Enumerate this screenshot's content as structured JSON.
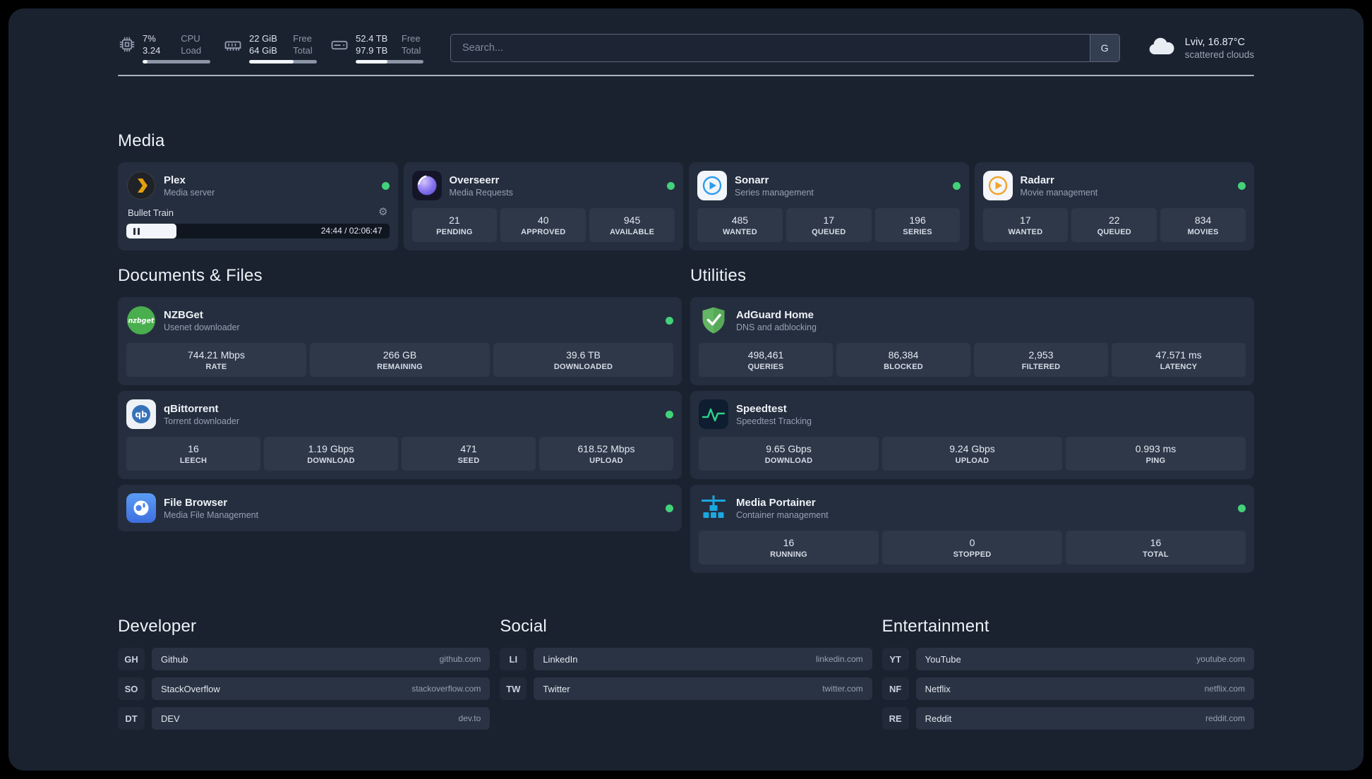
{
  "colors": {
    "status_online": "#43d17a",
    "plex_gold": "#e5a00d",
    "overseerr_purple": "#8b78f0",
    "sonarr_blue": "#2f9ceb",
    "radarr_amber": "#f0a42c",
    "nzbget_green": "#49ae4d",
    "qbittorrent_blue": "#3672b9",
    "filebrowser_blue": "#4b84ea",
    "adguard_green": "#63b663",
    "speedtest_green": "#2bd489",
    "portainer_blue": "#1ba7e0"
  },
  "topbar": {
    "cpu": {
      "icon": "cpu-icon",
      "value_top": "7%",
      "value_bottom": "3.24",
      "label_top": "CPU",
      "label_bottom": "Load",
      "bar_percent": 7
    },
    "memory": {
      "icon": "memory-icon",
      "value_top": "22 GiB",
      "value_bottom": "64 GiB",
      "label_top": "Free",
      "label_bottom": "Total",
      "bar_percent": 66
    },
    "disk": {
      "icon": "disk-icon",
      "value_top": "52.4 TB",
      "value_bottom": "97.9 TB",
      "label_top": "Free",
      "label_bottom": "Total",
      "bar_percent": 47
    },
    "search": {
      "placeholder": "Search...",
      "button_label": "G"
    },
    "weather": {
      "icon": "cloud-icon",
      "location": "Lviv, 16.87°C",
      "condition": "scattered clouds"
    }
  },
  "media": {
    "title": "Media",
    "services": [
      {
        "name": "Plex",
        "subtitle": "Media server",
        "icon": "plex-icon",
        "online": true,
        "player": {
          "title": "Bullet Train",
          "time_display": "24:44 / 02:06:47",
          "progress_percent": 19
        }
      },
      {
        "name": "Overseerr",
        "subtitle": "Media Requests",
        "icon": "overseerr-icon",
        "online": true,
        "stats": [
          {
            "value": "21",
            "label": "PENDING"
          },
          {
            "value": "40",
            "label": "APPROVED"
          },
          {
            "value": "945",
            "label": "AVAILABLE"
          }
        ]
      },
      {
        "name": "Sonarr",
        "subtitle": "Series management",
        "icon": "sonarr-icon",
        "online": true,
        "stats": [
          {
            "value": "485",
            "label": "WANTED"
          },
          {
            "value": "17",
            "label": "QUEUED"
          },
          {
            "value": "196",
            "label": "SERIES"
          }
        ]
      },
      {
        "name": "Radarr",
        "subtitle": "Movie management",
        "icon": "radarr-icon",
        "online": true,
        "stats": [
          {
            "value": "17",
            "label": "WANTED"
          },
          {
            "value": "22",
            "label": "QUEUED"
          },
          {
            "value": "834",
            "label": "MOVIES"
          }
        ]
      }
    ]
  },
  "documents": {
    "title": "Documents & Files",
    "services": [
      {
        "name": "NZBGet",
        "subtitle": "Usenet downloader",
        "icon": "nzbget-icon",
        "online": true,
        "stats": [
          {
            "value": "744.21 Mbps",
            "label": "RATE"
          },
          {
            "value": "266 GB",
            "label": "REMAINING"
          },
          {
            "value": "39.6 TB",
            "label": "DOWNLOADED"
          }
        ]
      },
      {
        "name": "qBittorrent",
        "subtitle": "Torrent downloader",
        "icon": "qbittorrent-icon",
        "online": true,
        "stats": [
          {
            "value": "16",
            "label": "LEECH"
          },
          {
            "value": "1.19 Gbps",
            "label": "DOWNLOAD"
          },
          {
            "value": "471",
            "label": "SEED"
          },
          {
            "value": "618.52 Mbps",
            "label": "UPLOAD"
          }
        ]
      },
      {
        "name": "File Browser",
        "subtitle": "Media File Management",
        "icon": "filebrowser-icon",
        "online": true,
        "stats": []
      }
    ]
  },
  "utilities": {
    "title": "Utilities",
    "services": [
      {
        "name": "AdGuard Home",
        "subtitle": "DNS and adblocking",
        "icon": "adguard-icon",
        "online": false,
        "stats": [
          {
            "value": "498,461",
            "label": "QUERIES"
          },
          {
            "value": "86,384",
            "label": "BLOCKED"
          },
          {
            "value": "2,953",
            "label": "FILTERED"
          },
          {
            "value": "47.571 ms",
            "label": "LATENCY"
          }
        ]
      },
      {
        "name": "Speedtest",
        "subtitle": "Speedtest Tracking",
        "icon": "speedtest-icon",
        "online": false,
        "stats": [
          {
            "value": "9.65 Gbps",
            "label": "DOWNLOAD"
          },
          {
            "value": "9.24 Gbps",
            "label": "UPLOAD"
          },
          {
            "value": "0.993 ms",
            "label": "PING"
          }
        ]
      },
      {
        "name": "Media Portainer",
        "subtitle": "Container management",
        "icon": "portainer-icon",
        "online": true,
        "stats": [
          {
            "value": "16",
            "label": "RUNNING"
          },
          {
            "value": "0",
            "label": "STOPPED"
          },
          {
            "value": "16",
            "label": "TOTAL"
          }
        ]
      }
    ]
  },
  "bookmarks": {
    "columns": [
      {
        "title": "Developer",
        "items": [
          {
            "abbr": "GH",
            "name": "Github",
            "domain": "github.com"
          },
          {
            "abbr": "SO",
            "name": "StackOverflow",
            "domain": "stackoverflow.com"
          },
          {
            "abbr": "DT",
            "name": "DEV",
            "domain": "dev.to"
          }
        ]
      },
      {
        "title": "Social",
        "items": [
          {
            "abbr": "LI",
            "name": "LinkedIn",
            "domain": "linkedin.com"
          },
          {
            "abbr": "TW",
            "name": "Twitter",
            "domain": "twitter.com"
          }
        ]
      },
      {
        "title": "Entertainment",
        "items": [
          {
            "abbr": "YT",
            "name": "YouTube",
            "domain": "youtube.com"
          },
          {
            "abbr": "NF",
            "name": "Netflix",
            "domain": "netflix.com"
          },
          {
            "abbr": "RE",
            "name": "Reddit",
            "domain": "reddit.com"
          }
        ]
      }
    ]
  }
}
